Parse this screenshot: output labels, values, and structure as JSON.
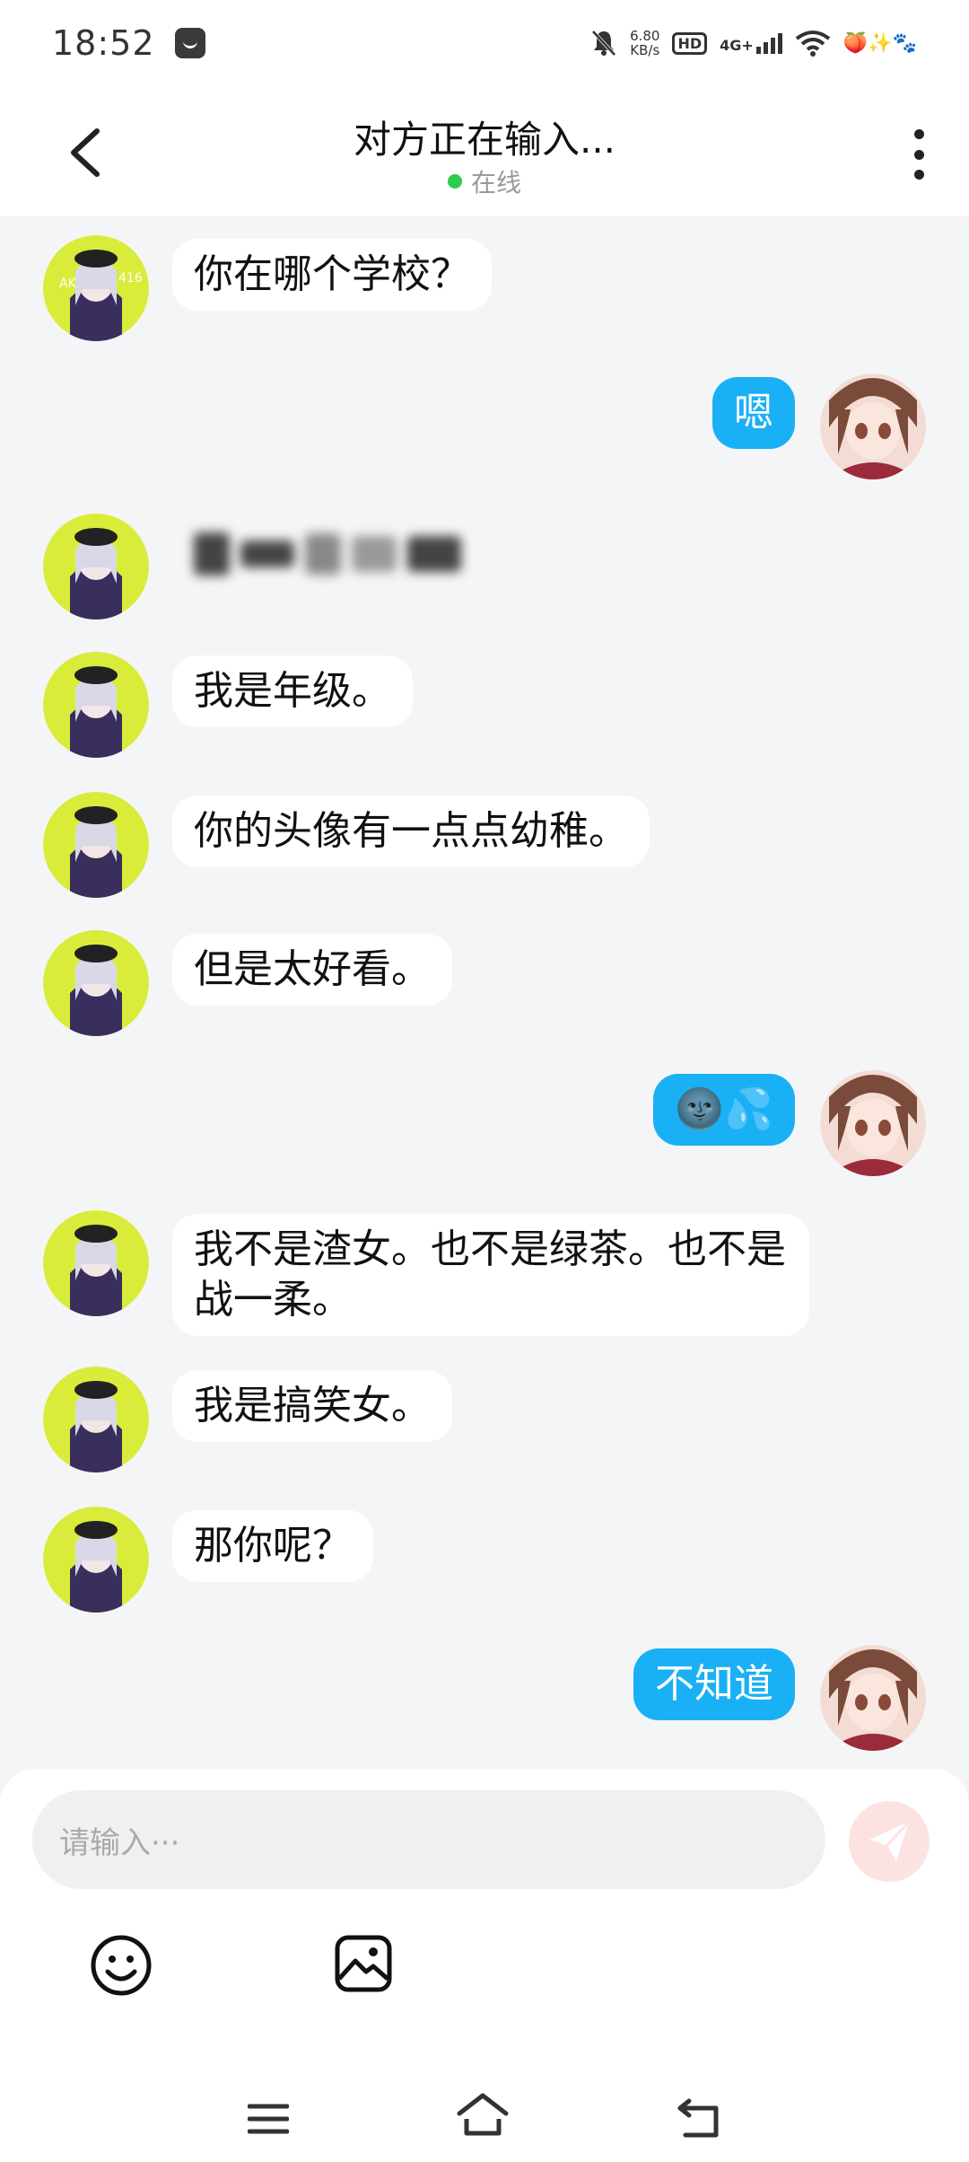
{
  "status_bar": {
    "time": "18:52",
    "net_speed_value": "6.80",
    "net_speed_unit": "KB/s",
    "hd_badge": "HD",
    "signal_label": "4G+"
  },
  "header": {
    "title": "对方正在输入...",
    "status": "在线",
    "status_color": "#2ecc4a"
  },
  "messages": [
    {
      "side": "left",
      "text": "你在哪个学校？"
    },
    {
      "side": "right",
      "text": "嗯"
    },
    {
      "side": "left",
      "text": ""
    },
    {
      "side": "left",
      "text": "我是年级。"
    },
    {
      "side": "left",
      "text": "你的头像有一点点幼稚。"
    },
    {
      "side": "left",
      "text": "但是太好看。"
    },
    {
      "side": "right",
      "text": "🌚💦"
    },
    {
      "side": "left",
      "text": "我不是渣女。也不是绿茶。也不是战一柔。"
    },
    {
      "side": "left",
      "text": "我是搞笑女。"
    },
    {
      "side": "left",
      "text": "那你呢？"
    },
    {
      "side": "right",
      "text": "不知道"
    }
  ],
  "input": {
    "placeholder": "请输入···"
  },
  "colors": {
    "accent": "#1ab0f5",
    "background": "#f4f5f7"
  }
}
